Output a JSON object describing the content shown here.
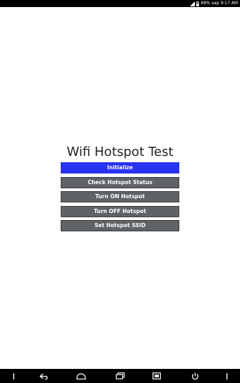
{
  "status_bar": {
    "battery": "69%",
    "time": "9:17 AM",
    "carrier": "sap"
  },
  "app": {
    "title": "Wifi Hotspot Test"
  },
  "buttons": {
    "initialize": "Initialize",
    "check_status": "Check Hotspot Status",
    "turn_on": "Turn ON Hotspot",
    "turn_off": "Turn OFF Hotspot",
    "set_ssid": "Set Hotspot SSID"
  },
  "colors": {
    "accent_blue": "#2832f2",
    "button_gray": "#5f6367",
    "bar_black": "#000000"
  },
  "nav_icons": [
    "menu-icon",
    "back-icon",
    "home-icon",
    "recent-apps-icon",
    "screenshot-icon",
    "power-icon",
    "more-icon"
  ]
}
